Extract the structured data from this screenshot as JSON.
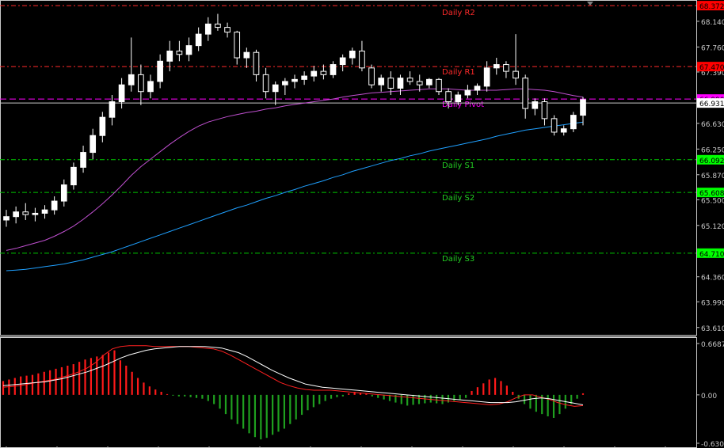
{
  "chart_data": [
    {
      "type": "candlestick",
      "ylim": [
        63.49,
        68.42
      ],
      "yticks": [
        "68.140",
        "67.760",
        "67.390",
        "66.630",
        "66.250",
        "65.870",
        "65.500",
        "65.120",
        "64.360",
        "63.990",
        "63.610"
      ],
      "price_tags": [
        {
          "label": "68.372",
          "value": 68.372,
          "bg": "#ff0000",
          "fg": "#000000"
        },
        {
          "label": "67.470",
          "value": 67.47,
          "bg": "#ff0000",
          "fg": "#000000"
        },
        {
          "label": "66.990",
          "value": 66.99,
          "bg": "#ff00ff",
          "fg": "#000000"
        },
        {
          "label": "66.931",
          "value": 66.931,
          "bg": "#ffffff",
          "fg": "#000000"
        },
        {
          "label": "66.092",
          "value": 66.092,
          "bg": "#00ff00",
          "fg": "#000000"
        },
        {
          "label": "65.608",
          "value": 65.608,
          "bg": "#00ff00",
          "fg": "#000000"
        },
        {
          "label": "64.710",
          "value": 64.71,
          "bg": "#00ff00",
          "fg": "#000000"
        }
      ],
      "levels": [
        {
          "name": "Daily R2",
          "value": 68.372,
          "color": "#ff2a2a",
          "label_color": "#ff2a2a"
        },
        {
          "name": "Daily R1",
          "value": 67.47,
          "color": "#ff2a2a",
          "label_color": "#ff2a2a"
        },
        {
          "name": "Daily Pivot",
          "value": 66.99,
          "color": "#ff00ff",
          "label_color": "#ff00ff",
          "dashed_long": true
        },
        {
          "name": "Daily S1",
          "value": 66.092,
          "color": "#00c800",
          "label_color": "#22cc22"
        },
        {
          "name": "Daily S2",
          "value": 65.608,
          "color": "#00c800",
          "label_color": "#22cc22"
        },
        {
          "name": "Daily S3",
          "value": 64.71,
          "color": "#00c800",
          "label_color": "#22cc22"
        }
      ],
      "colors": {
        "bull": "#ffffff",
        "bear": "#000000",
        "wick": "#ffffff",
        "ma_fast": "#c050d0",
        "ma_slow": "#1fa0ff",
        "current_price_line": "#c8c8c8"
      },
      "candles": [
        [
          65.2,
          65.35,
          65.1,
          65.25
        ],
        [
          65.25,
          65.4,
          65.15,
          65.32
        ],
        [
          65.32,
          65.45,
          65.2,
          65.28
        ],
        [
          65.28,
          65.38,
          65.18,
          65.3
        ],
        [
          65.3,
          65.42,
          65.22,
          65.35
        ],
        [
          65.35,
          65.55,
          65.28,
          65.48
        ],
        [
          65.48,
          65.8,
          65.4,
          65.72
        ],
        [
          65.72,
          66.05,
          65.65,
          65.98
        ],
        [
          65.98,
          66.3,
          65.9,
          66.2
        ],
        [
          66.2,
          66.55,
          66.1,
          66.45
        ],
        [
          66.45,
          66.8,
          66.35,
          66.72
        ],
        [
          66.72,
          67.05,
          66.6,
          66.95
        ],
        [
          66.95,
          67.3,
          66.85,
          67.2
        ],
        [
          67.2,
          67.9,
          67.1,
          67.35
        ],
        [
          67.35,
          67.5,
          66.9,
          67.1
        ],
        [
          67.1,
          67.35,
          67.0,
          67.25
        ],
        [
          67.25,
          67.65,
          67.15,
          67.55
        ],
        [
          67.55,
          67.85,
          67.4,
          67.7
        ],
        [
          67.7,
          67.85,
          67.55,
          67.65
        ],
        [
          67.65,
          67.9,
          67.55,
          67.78
        ],
        [
          67.78,
          68.05,
          67.7,
          67.95
        ],
        [
          67.95,
          68.2,
          67.85,
          68.1
        ],
        [
          68.1,
          68.25,
          68.0,
          68.05
        ],
        [
          68.05,
          68.12,
          67.9,
          67.98
        ],
        [
          67.98,
          68.0,
          67.5,
          67.6
        ],
        [
          67.6,
          67.75,
          67.45,
          67.68
        ],
        [
          67.68,
          67.72,
          67.25,
          67.35
        ],
        [
          67.35,
          67.45,
          67.0,
          67.1
        ],
        [
          67.1,
          67.25,
          66.9,
          67.2
        ],
        [
          67.2,
          67.3,
          67.05,
          67.25
        ],
        [
          67.25,
          67.35,
          67.15,
          67.28
        ],
        [
          67.28,
          67.4,
          67.2,
          67.33
        ],
        [
          67.33,
          67.48,
          67.25,
          67.4
        ],
        [
          67.4,
          67.5,
          67.28,
          67.35
        ],
        [
          67.35,
          67.55,
          67.3,
          67.5
        ],
        [
          67.5,
          67.65,
          67.4,
          67.6
        ],
        [
          67.6,
          67.75,
          67.5,
          67.7
        ],
        [
          67.7,
          67.85,
          67.4,
          67.45
        ],
        [
          67.45,
          67.5,
          67.15,
          67.2
        ],
        [
          67.2,
          67.35,
          67.1,
          67.3
        ],
        [
          67.3,
          67.4,
          67.05,
          67.15
        ],
        [
          67.15,
          67.35,
          67.05,
          67.3
        ],
        [
          67.3,
          67.4,
          67.2,
          67.25
        ],
        [
          67.25,
          67.35,
          67.1,
          67.2
        ],
        [
          67.2,
          67.3,
          67.15,
          67.28
        ],
        [
          67.28,
          67.3,
          67.05,
          67.1
        ],
        [
          67.1,
          67.15,
          66.85,
          66.95
        ],
        [
          66.95,
          67.1,
          66.9,
          67.05
        ],
        [
          67.05,
          67.2,
          67.0,
          67.12
        ],
        [
          67.12,
          67.22,
          67.05,
          67.18
        ],
        [
          67.18,
          67.55,
          67.1,
          67.45
        ],
        [
          67.45,
          67.6,
          67.35,
          67.5
        ],
        [
          67.5,
          67.55,
          67.3,
          67.4
        ],
        [
          67.4,
          67.95,
          67.2,
          67.3
        ],
        [
          67.3,
          67.35,
          66.7,
          66.85
        ],
        [
          66.85,
          67.0,
          66.75,
          66.95
        ],
        [
          66.95,
          67.0,
          66.6,
          66.7
        ],
        [
          66.7,
          66.75,
          66.45,
          66.5
        ],
        [
          66.5,
          66.6,
          66.45,
          66.55
        ],
        [
          66.55,
          66.8,
          66.5,
          66.75
        ],
        [
          66.75,
          67.02,
          66.6,
          66.98
        ]
      ],
      "ma_fast": [
        64.75,
        64.78,
        64.82,
        64.86,
        64.9,
        64.96,
        65.03,
        65.11,
        65.21,
        65.32,
        65.44,
        65.57,
        65.71,
        65.86,
        65.99,
        66.1,
        66.21,
        66.32,
        66.42,
        66.51,
        66.59,
        66.65,
        66.69,
        66.73,
        66.76,
        66.79,
        66.81,
        66.84,
        66.86,
        66.89,
        66.91,
        66.93,
        66.95,
        66.97,
        66.99,
        67.02,
        67.04,
        67.06,
        67.08,
        67.09,
        67.1,
        67.11,
        67.12,
        67.13,
        67.14,
        67.14,
        67.14,
        67.13,
        67.12,
        67.12,
        67.12,
        67.12,
        67.13,
        67.14,
        67.14,
        67.13,
        67.12,
        67.1,
        67.07,
        67.04,
        67.02
      ],
      "ma_slow": [
        64.45,
        64.46,
        64.47,
        64.49,
        64.51,
        64.53,
        64.55,
        64.58,
        64.61,
        64.65,
        64.69,
        64.73,
        64.78,
        64.83,
        64.88,
        64.93,
        64.98,
        65.03,
        65.08,
        65.13,
        65.18,
        65.23,
        65.28,
        65.33,
        65.38,
        65.42,
        65.47,
        65.52,
        65.56,
        65.61,
        65.65,
        65.7,
        65.74,
        65.78,
        65.83,
        65.87,
        65.92,
        65.96,
        66.0,
        66.04,
        66.08,
        66.11,
        66.15,
        66.18,
        66.22,
        66.25,
        66.28,
        66.31,
        66.34,
        66.37,
        66.4,
        66.44,
        66.47,
        66.5,
        66.53,
        66.55,
        66.57,
        66.59,
        66.61,
        66.63,
        66.65
      ]
    },
    {
      "type": "macd-histogram",
      "ylim": [
        -0.6303,
        0.66878
      ],
      "yticks": [
        "0.66878",
        "0.00",
        "-0.6303"
      ],
      "colors": {
        "positive": "#ff1a1a",
        "negative": "#1fa01f",
        "macd_line": "#ffffff",
        "signal_line": "#ff2020"
      },
      "histogram": [
        0.18,
        0.2,
        0.22,
        0.24,
        0.25,
        0.26,
        0.28,
        0.3,
        0.32,
        0.34,
        0.36,
        0.38,
        0.4,
        0.43,
        0.46,
        0.48,
        0.5,
        0.52,
        0.55,
        0.58,
        0.45,
        0.38,
        0.3,
        0.22,
        0.16,
        0.11,
        0.07,
        0.04,
        0.01,
        -0.01,
        -0.02,
        -0.02,
        -0.03,
        -0.04,
        -0.05,
        -0.08,
        -0.12,
        -0.18,
        -0.25,
        -0.32,
        -0.38,
        -0.44,
        -0.5,
        -0.55,
        -0.58,
        -0.56,
        -0.52,
        -0.48,
        -0.44,
        -0.38,
        -0.32,
        -0.26,
        -0.2,
        -0.16,
        -0.12,
        -0.08,
        -0.05,
        -0.03,
        -0.02,
        0.02,
        0.04,
        0.03,
        0.02,
        -0.02,
        -0.04,
        -0.06,
        -0.08,
        -0.1,
        -0.12,
        -0.14,
        -0.13,
        -0.12,
        -0.11,
        -0.1,
        -0.11,
        -0.12,
        -0.1,
        -0.08,
        -0.06,
        -0.04,
        0.05,
        0.1,
        0.15,
        0.2,
        0.22,
        0.18,
        0.12,
        0.04,
        -0.05,
        -0.12,
        -0.18,
        -0.22,
        -0.25,
        -0.28,
        -0.3,
        -0.25,
        -0.18,
        -0.12,
        -0.05,
        0.02
      ],
      "macd_line": [
        0.12,
        0.13,
        0.14,
        0.15,
        0.16,
        0.17,
        0.19,
        0.21,
        0.24,
        0.27,
        0.3,
        0.34,
        0.38,
        0.43,
        0.48,
        0.52,
        0.55,
        0.58,
        0.6,
        0.61,
        0.62,
        0.63,
        0.63,
        0.63,
        0.63,
        0.62,
        0.61,
        0.58,
        0.55,
        0.5,
        0.44,
        0.38,
        0.32,
        0.27,
        0.22,
        0.18,
        0.14,
        0.12,
        0.1,
        0.09,
        0.08,
        0.07,
        0.06,
        0.05,
        0.04,
        0.03,
        0.02,
        0.01,
        0.0,
        -0.01,
        -0.02,
        -0.03,
        -0.04,
        -0.05,
        -0.06,
        -0.07,
        -0.08,
        -0.09,
        -0.1,
        -0.1,
        -0.1,
        -0.09,
        -0.07,
        -0.05,
        -0.04,
        -0.05,
        -0.07,
        -0.09,
        -0.11,
        -0.13
      ],
      "signal_line": [
        0.1,
        0.11,
        0.12,
        0.14,
        0.16,
        0.18,
        0.2,
        0.23,
        0.26,
        0.3,
        0.35,
        0.42,
        0.52,
        0.6,
        0.63,
        0.64,
        0.64,
        0.64,
        0.63,
        0.63,
        0.63,
        0.63,
        0.63,
        0.62,
        0.61,
        0.6,
        0.57,
        0.52,
        0.46,
        0.4,
        0.34,
        0.28,
        0.22,
        0.16,
        0.12,
        0.09,
        0.07,
        0.06,
        0.06,
        0.06,
        0.05,
        0.04,
        0.03,
        0.02,
        0.01,
        0.0,
        -0.01,
        -0.02,
        -0.03,
        -0.04,
        -0.05,
        -0.06,
        -0.07,
        -0.08,
        -0.09,
        -0.1,
        -0.11,
        -0.12,
        -0.13,
        -0.12,
        -0.09,
        -0.04,
        0.0,
        0.0,
        -0.03,
        -0.06,
        -0.1,
        -0.13,
        -0.15,
        -0.14
      ]
    }
  ]
}
